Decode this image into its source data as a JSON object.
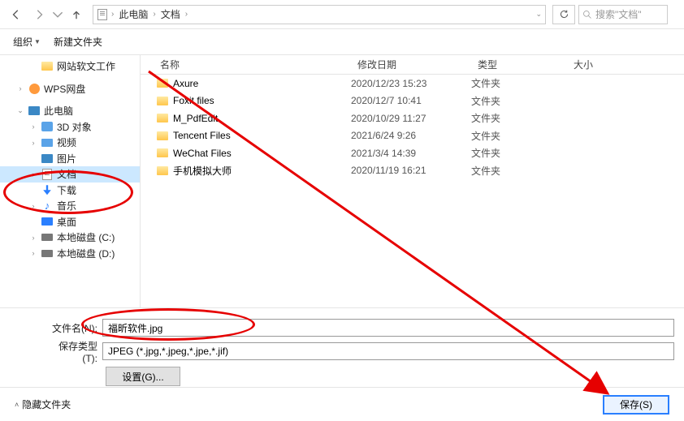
{
  "nav": {
    "breadcrumb": [
      "此电脑",
      "文档"
    ],
    "search_placeholder": "搜索\"文档\""
  },
  "toolbar": {
    "organize": "组织",
    "new_folder": "新建文件夹"
  },
  "sidebar": {
    "items": [
      {
        "label": "网站软文工作",
        "icon": "folder",
        "indent": 1,
        "chevron": ""
      },
      {
        "label": "",
        "spacer": true
      },
      {
        "label": "WPS网盘",
        "icon": "wps",
        "indent": 0,
        "chevron": "›"
      },
      {
        "label": "",
        "spacer": true
      },
      {
        "label": "此电脑",
        "icon": "pc",
        "indent": 0,
        "chevron": "⌄"
      },
      {
        "label": "3D 对象",
        "icon": "3d",
        "indent": 1,
        "chevron": "›"
      },
      {
        "label": "视频",
        "icon": "video",
        "indent": 1,
        "chevron": "›"
      },
      {
        "label": "图片",
        "icon": "pic",
        "indent": 1,
        "chevron": ""
      },
      {
        "label": "文档",
        "icon": "doc",
        "indent": 1,
        "chevron": "›",
        "selected": true
      },
      {
        "label": "下载",
        "icon": "download",
        "indent": 1,
        "chevron": ""
      },
      {
        "label": "音乐",
        "icon": "music",
        "indent": 1,
        "chevron": "›"
      },
      {
        "label": "桌面",
        "icon": "desktop",
        "indent": 1,
        "chevron": ""
      },
      {
        "label": "本地磁盘 (C:)",
        "icon": "disk",
        "indent": 1,
        "chevron": "›"
      },
      {
        "label": "本地磁盘 (D:)",
        "icon": "disk",
        "indent": 1,
        "chevron": "›"
      }
    ]
  },
  "file_list": {
    "headers": {
      "name": "名称",
      "date": "修改日期",
      "type": "类型",
      "size": "大小"
    },
    "rows": [
      {
        "name": "Axure",
        "date": "2020/12/23 15:23",
        "type": "文件夹"
      },
      {
        "name": "Foxit files",
        "date": "2020/12/7 10:41",
        "type": "文件夹"
      },
      {
        "name": "M_PdfEdit",
        "date": "2020/10/29 11:27",
        "type": "文件夹"
      },
      {
        "name": "Tencent Files",
        "date": "2021/6/24 9:26",
        "type": "文件夹"
      },
      {
        "name": "WeChat Files",
        "date": "2021/3/4 14:39",
        "type": "文件夹"
      },
      {
        "name": "手机模拟大师",
        "date": "2020/11/19 16:21",
        "type": "文件夹"
      }
    ]
  },
  "form": {
    "filename_label": "文件名(N):",
    "filename_value": "福昕软件.jpg",
    "filetype_label": "保存类型(T):",
    "filetype_value": "JPEG (*.jpg,*.jpeg,*.jpe,*.jif)",
    "settings_label": "设置(G)..."
  },
  "footer": {
    "hide_folders": "隐藏文件夹",
    "save": "保存(S)"
  }
}
